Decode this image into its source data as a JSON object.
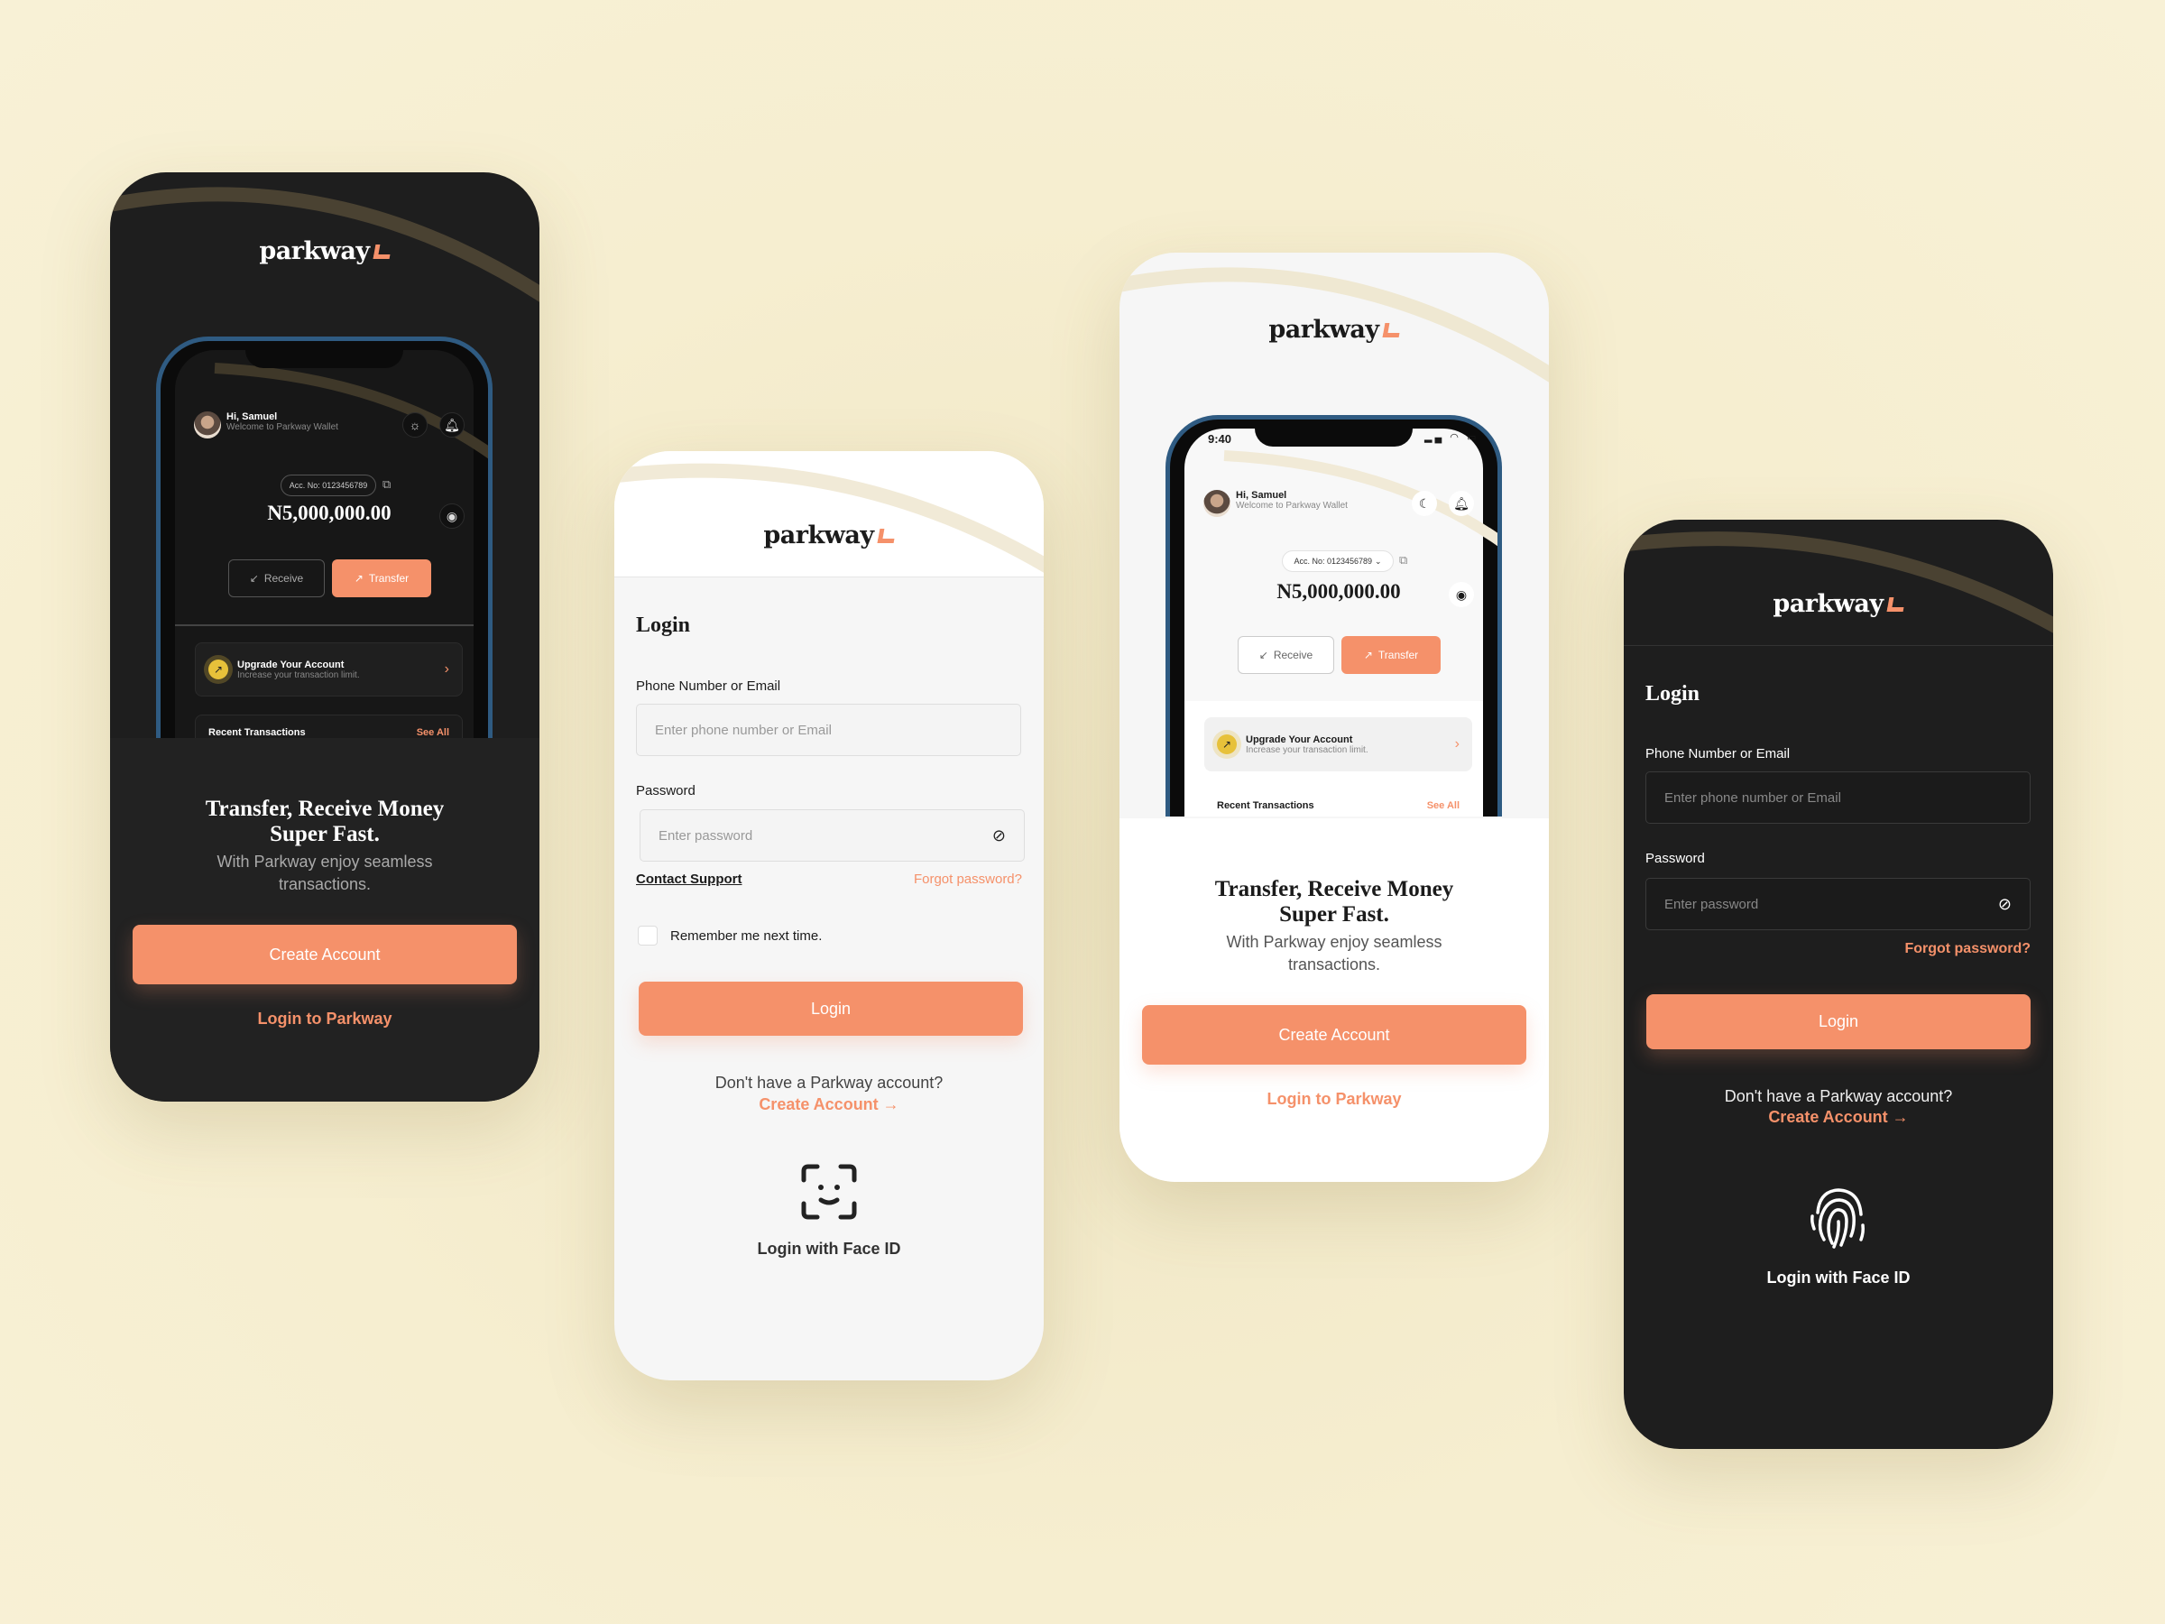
{
  "brand": {
    "name": "parkway",
    "accent": "#f5916a",
    "background": "#f6eed0",
    "dark": "#1e1e1e"
  },
  "wallet": {
    "status_time": "9:40",
    "greeting": "Hi, Samuel",
    "welcome": "Welcome to Parkway Wallet",
    "account": "Acc. No: 0123456789",
    "balance": "N5,000,000.00",
    "receive": "Receive",
    "transfer": "Transfer",
    "upgrade_title": "Upgrade Your Account",
    "upgrade_sub": "Increase your transaction limit.",
    "recent": "Recent Transactions",
    "see_all": "See All"
  },
  "onboarding": {
    "headline_1": "Transfer, Receive Money",
    "headline_2": "Super Fast.",
    "sub_1": "With Parkway enjoy seamless",
    "sub_2": "transactions.",
    "create": "Create Account",
    "login": "Login to Parkway"
  },
  "login_light": {
    "title": "Login",
    "phone_label": "Phone Number or Email",
    "phone_placeholder": "Enter phone number or Email",
    "password_label": "Password",
    "password_placeholder": "Enter password",
    "contact": "Contact Support",
    "forgot": "Forgot password?",
    "remember": "Remember me next time.",
    "login": "Login",
    "no_account": "Don't have a Parkway account?",
    "create": "Create Account →",
    "face": "Login with Face ID"
  },
  "login_dark": {
    "title": "Login",
    "phone_label": "Phone Number or Email",
    "phone_placeholder": "Enter phone number or Email",
    "password_label": "Password",
    "password_placeholder": "Enter password",
    "forgot": "Forgot password?",
    "login": "Login",
    "no_account": "Don't have a Parkway account?",
    "create": "Create Account →",
    "face": "Login with  Face ID"
  }
}
